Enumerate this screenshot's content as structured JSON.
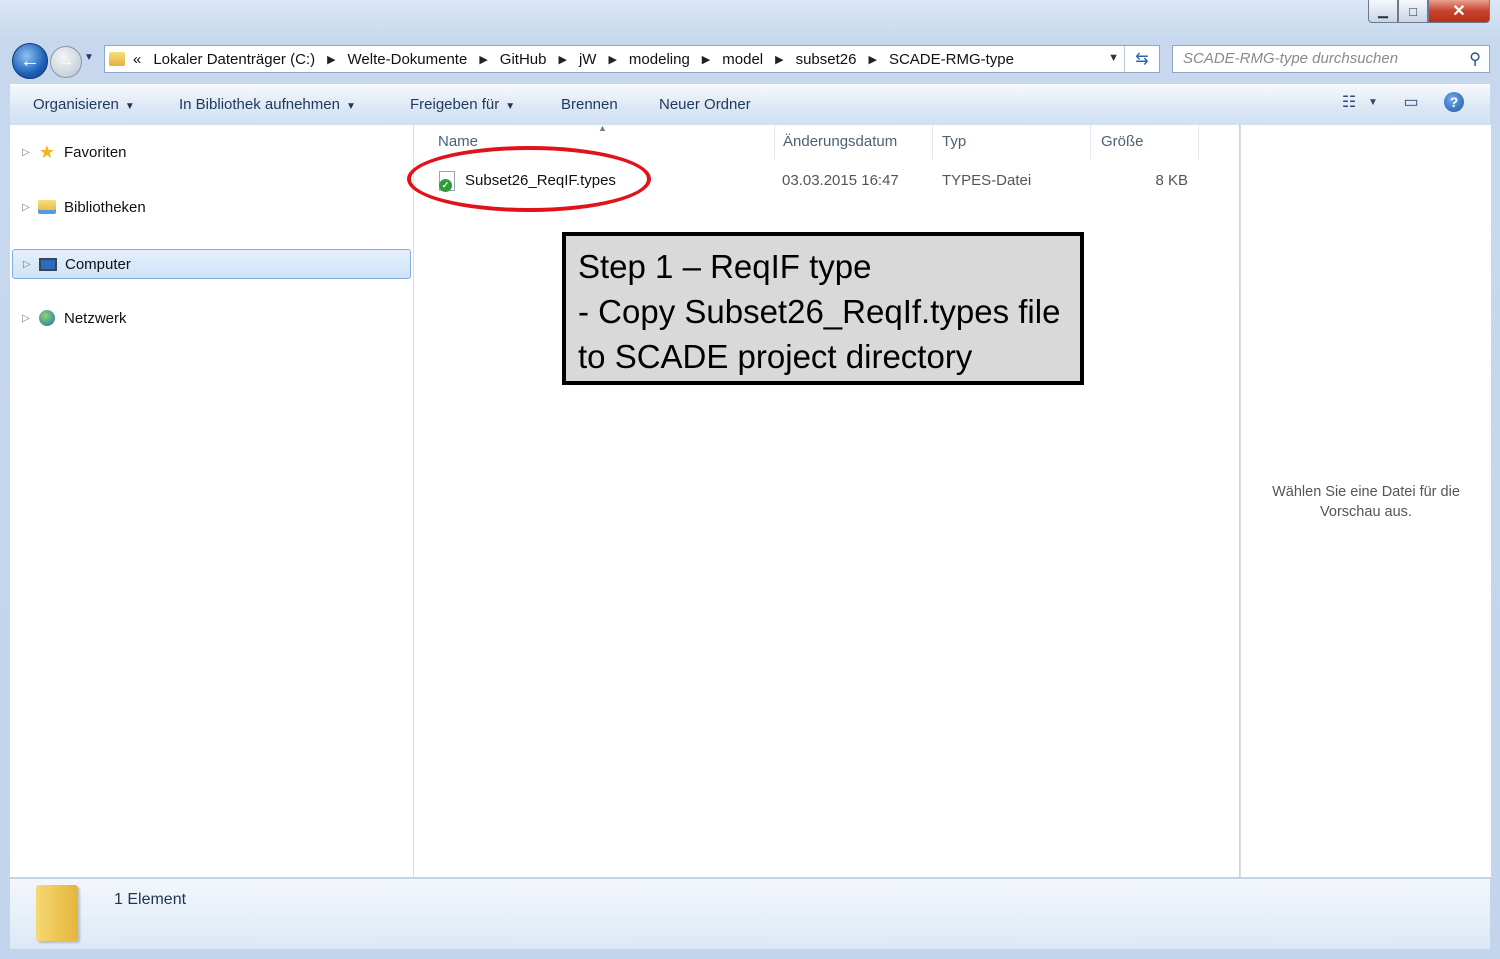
{
  "window": {
    "controls": {
      "minimize": "▁",
      "maximize": "□",
      "close": "✕"
    }
  },
  "nav": {
    "back_icon": "back-arrow-icon",
    "forward_icon": "forward-arrow-icon",
    "address_prefix": "«",
    "breadcrumbs": [
      "Lokaler Datenträger (C:)",
      "Welte-Dokumente",
      "GitHub",
      "jW",
      "modeling",
      "model",
      "subset26",
      "SCADE-RMG-type"
    ],
    "search_placeholder": "SCADE-RMG-type durchsuchen"
  },
  "toolbar": {
    "organize": "Organisieren",
    "include_library": "In Bibliothek aufnehmen",
    "share": "Freigeben für",
    "burn": "Brennen",
    "new_folder": "Neuer Ordner"
  },
  "sidebar": {
    "items": [
      {
        "label": "Favoriten",
        "icon": "star-icon"
      },
      {
        "label": "Bibliotheken",
        "icon": "library-icon"
      },
      {
        "label": "Computer",
        "icon": "computer-icon",
        "selected": true
      },
      {
        "label": "Netzwerk",
        "icon": "network-icon"
      }
    ]
  },
  "file_list": {
    "columns": {
      "name": "Name",
      "date": "Änderungsdatum",
      "type": "Typ",
      "size": "Größe"
    },
    "rows": [
      {
        "name": "Subset26_ReqIF.types",
        "date": "03.03.2015 16:47",
        "type": "TYPES-Datei",
        "size": "8 KB"
      }
    ]
  },
  "annotation": {
    "color": "#e0121a",
    "callout_lines": [
      "Step 1 – ReqIF type",
      "- Copy Subset26_ReqIf.types file",
      "to SCADE project directory"
    ]
  },
  "preview": {
    "message_line1": "Wählen Sie eine Datei für die",
    "message_line2": "Vorschau aus."
  },
  "details": {
    "count": "1 Element"
  }
}
